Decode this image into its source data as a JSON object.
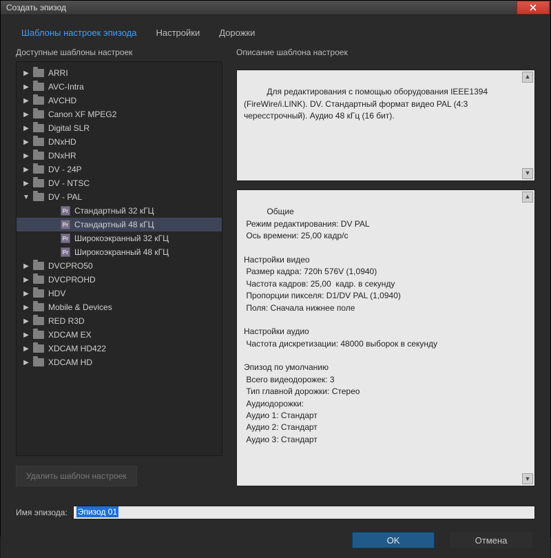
{
  "window": {
    "title": "Создать эпизод"
  },
  "tabs": [
    {
      "label": "Шаблоны настроек эпизода",
      "active": true
    },
    {
      "label": "Настройки",
      "active": false
    },
    {
      "label": "Дорожки",
      "active": false
    }
  ],
  "left": {
    "header": "Доступные шаблоны настроек",
    "delete_label": "Удалить шаблон настроек",
    "tree": [
      {
        "label": "ARRI",
        "expanded": false
      },
      {
        "label": "AVC-Intra",
        "expanded": false
      },
      {
        "label": "AVCHD",
        "expanded": false
      },
      {
        "label": "Canon XF MPEG2",
        "expanded": false
      },
      {
        "label": "Digital SLR",
        "expanded": false
      },
      {
        "label": "DNxHD",
        "expanded": false
      },
      {
        "label": "DNxHR",
        "expanded": false
      },
      {
        "label": "DV - 24P",
        "expanded": false
      },
      {
        "label": "DV - NTSC",
        "expanded": false
      },
      {
        "label": "DV - PAL",
        "expanded": true,
        "children": [
          {
            "label": "Стандартный 32 кГЦ",
            "selected": false
          },
          {
            "label": "Стандартный 48 кГЦ",
            "selected": true
          },
          {
            "label": "Широкоэкранный 32 кГЦ",
            "selected": false
          },
          {
            "label": "Широкоэкранный 48 кГЦ",
            "selected": false
          }
        ]
      },
      {
        "label": "DVCPRO50",
        "expanded": false
      },
      {
        "label": "DVCPROHD",
        "expanded": false
      },
      {
        "label": "HDV",
        "expanded": false
      },
      {
        "label": "Mobile & Devices",
        "expanded": false
      },
      {
        "label": "RED R3D",
        "expanded": false
      },
      {
        "label": "XDCAM EX",
        "expanded": false
      },
      {
        "label": "XDCAM HD422",
        "expanded": false
      },
      {
        "label": "XDCAM HD",
        "expanded": false
      }
    ]
  },
  "right": {
    "header": "Описание шаблона настроек",
    "description": "Для редактирования с помощью оборудования IEEE1394 (FireWire/i.LINK). DV. Стандартный формат видео PAL (4:3 чересстрочный). Аудио 48 кГц (16 бит).",
    "details": "Общие\n Режим редактирования: DV PAL\n Ось времени: 25,00 кадр/с\n\nНастройки видео\n Размер кадра: 720h 576V (1,0940)\n Частота кадров: 25,00  кадр. в секунду\n Пропорции пикселя: D1/DV PAL (1,0940)\n Поля: Сначала нижнее поле\n\nНастройки аудио\n Частота дискретизации: 48000 выборок в секунду\n\nЭпизод по умолчанию\n Всего видеодорожек: 3\n Тип главной дорожки: Стерео\n Аудиодорожки:\n Аудио 1: Стандарт\n Аудио 2: Стандарт\n Аудио 3: Стандарт"
  },
  "footer": {
    "name_label": "Имя эпизода:",
    "name_value": "Эпизод 01",
    "ok": "OK",
    "cancel": "Отмена"
  }
}
